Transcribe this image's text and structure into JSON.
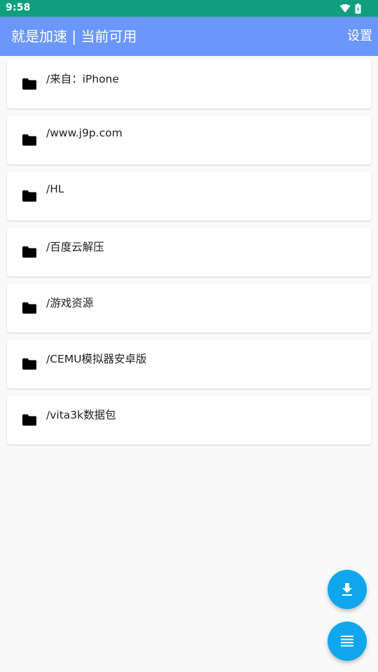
{
  "status_bar": {
    "time": "9:58",
    "icons": [
      "wifi-icon",
      "battery-icon"
    ]
  },
  "app_bar": {
    "title": "就是加速 | 当前可用",
    "settings_label": "设置"
  },
  "folders": [
    {
      "label": "/来自：iPhone",
      "icon": "folder-icon"
    },
    {
      "label": "/www.j9p.com",
      "icon": "folder-icon"
    },
    {
      "label": "/HL",
      "icon": "folder-icon"
    },
    {
      "label": "/百度云解压",
      "icon": "folder-icon"
    },
    {
      "label": "/游戏资源",
      "icon": "folder-icon"
    },
    {
      "label": "/CEMU模拟器安卓版",
      "icon": "folder-icon"
    },
    {
      "label": "/vita3k数据包",
      "icon": "folder-icon"
    }
  ],
  "fabs": [
    {
      "name": "download-button",
      "icon": "download-icon"
    },
    {
      "name": "menu-button",
      "icon": "list-icon"
    }
  ],
  "colors": {
    "status_bar": "#0f9f7e",
    "app_bar": "#6b97fd",
    "fab": "#0fa6ed",
    "background": "#f9f9f9"
  }
}
